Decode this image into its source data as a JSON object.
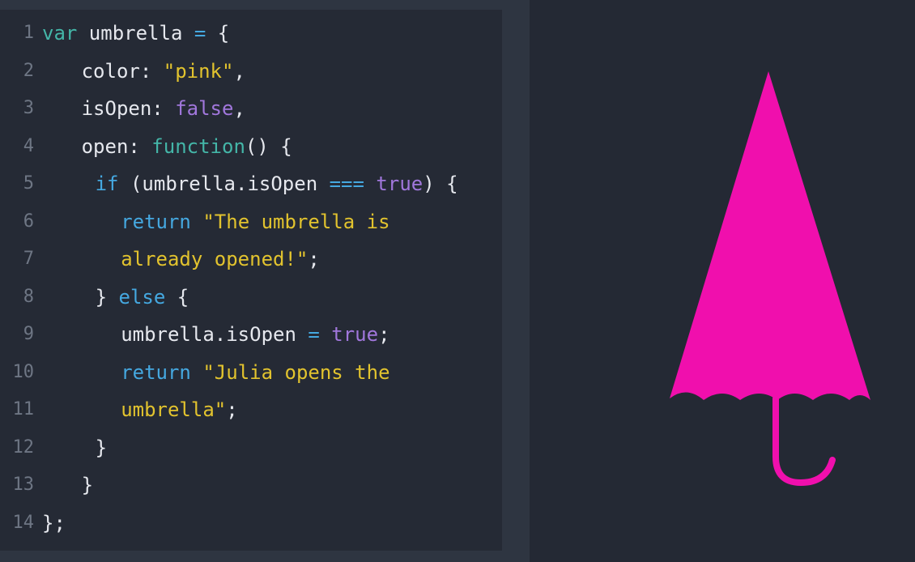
{
  "editor": {
    "lines": [
      {
        "number": "1",
        "indent": 0,
        "tokens": [
          {
            "t": "var",
            "c": "keyword"
          },
          {
            "t": " umbrella ",
            "c": "plain"
          },
          {
            "t": "=",
            "c": "op"
          },
          {
            "t": " {",
            "c": "plain"
          }
        ]
      },
      {
        "number": "2",
        "indent": 2,
        "tokens": [
          {
            "t": "color: ",
            "c": "plain"
          },
          {
            "t": "\"pink\"",
            "c": "string"
          },
          {
            "t": ",",
            "c": "plain"
          }
        ]
      },
      {
        "number": "3",
        "indent": 2,
        "tokens": [
          {
            "t": "isOpen: ",
            "c": "plain"
          },
          {
            "t": "false",
            "c": "bool"
          },
          {
            "t": ",",
            "c": "plain"
          }
        ]
      },
      {
        "number": "4",
        "indent": 2,
        "tokens": [
          {
            "t": "open: ",
            "c": "plain"
          },
          {
            "t": "function",
            "c": "keyword"
          },
          {
            "t": "() {",
            "c": "plain"
          }
        ]
      },
      {
        "number": "5",
        "indent": 2.7,
        "tokens": [
          {
            "t": "if",
            "c": "keyword2"
          },
          {
            "t": " (umbrella.isOpen ",
            "c": "plain"
          },
          {
            "t": "===",
            "c": "op"
          },
          {
            "t": " ",
            "c": "plain"
          },
          {
            "t": "true",
            "c": "bool"
          },
          {
            "t": ") {",
            "c": "plain"
          }
        ]
      },
      {
        "number": "6",
        "indent": 4,
        "tokens": [
          {
            "t": "return",
            "c": "keyword2"
          },
          {
            "t": " ",
            "c": "plain"
          },
          {
            "t": "\"The umbrella is",
            "c": "string"
          }
        ]
      },
      {
        "number": "7",
        "indent": 4,
        "tokens": [
          {
            "t": "already opened!\"",
            "c": "string"
          },
          {
            "t": ";",
            "c": "plain"
          }
        ]
      },
      {
        "number": "8",
        "indent": 2.7,
        "tokens": [
          {
            "t": "} ",
            "c": "plain"
          },
          {
            "t": "else",
            "c": "keyword2"
          },
          {
            "t": " {",
            "c": "plain"
          }
        ]
      },
      {
        "number": "9",
        "indent": 4,
        "tokens": [
          {
            "t": "umbrella.isOpen ",
            "c": "plain"
          },
          {
            "t": "=",
            "c": "op"
          },
          {
            "t": " ",
            "c": "plain"
          },
          {
            "t": "true",
            "c": "bool"
          },
          {
            "t": ";",
            "c": "plain"
          }
        ]
      },
      {
        "number": "10",
        "indent": 4,
        "tokens": [
          {
            "t": "return",
            "c": "keyword2"
          },
          {
            "t": " ",
            "c": "plain"
          },
          {
            "t": "\"Julia opens the",
            "c": "string"
          }
        ]
      },
      {
        "number": "11",
        "indent": 4,
        "tokens": [
          {
            "t": "umbrella\"",
            "c": "string"
          },
          {
            "t": ";",
            "c": "plain"
          }
        ]
      },
      {
        "number": "12",
        "indent": 2.7,
        "tokens": [
          {
            "t": "}",
            "c": "plain"
          }
        ]
      },
      {
        "number": "13",
        "indent": 2,
        "tokens": [
          {
            "t": "}",
            "c": "plain"
          }
        ]
      },
      {
        "number": "14",
        "indent": 0,
        "tokens": [
          {
            "t": "};",
            "c": "plain"
          }
        ]
      }
    ]
  },
  "preview": {
    "umbrella_color": "#f00fad",
    "umbrella_state": "closed"
  },
  "colors": {
    "background": "#2e3541",
    "editor_background": "#252a35",
    "preview_background": "#242934",
    "keyword": "#44b6a8",
    "keyword2": "#45a8e0",
    "string": "#e2c32e",
    "boolean": "#a177dc",
    "operator": "#45a8e0",
    "plain": "#e6e8ee",
    "line_number": "#6e7684"
  }
}
